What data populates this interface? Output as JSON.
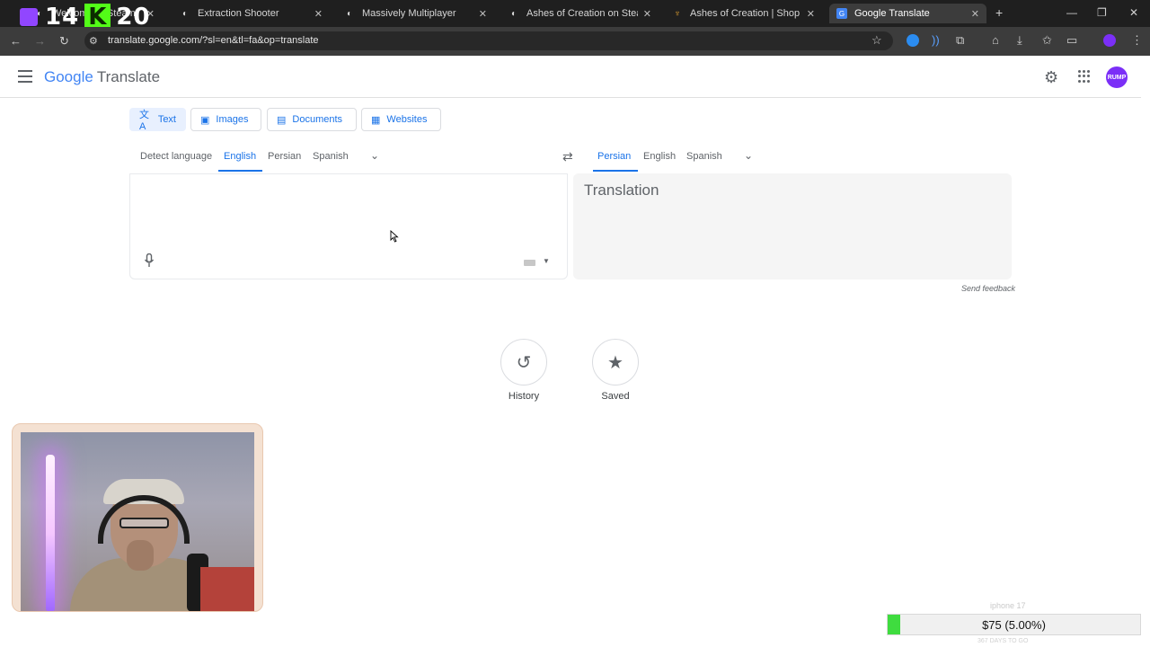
{
  "browser": {
    "tabs": [
      {
        "title": "Welcome to Steam",
        "active": false
      },
      {
        "title": "Extraction Shooter",
        "active": false
      },
      {
        "title": "Massively Multiplayer",
        "active": false
      },
      {
        "title": "Ashes of Creation on Steam",
        "active": false
      },
      {
        "title": "Ashes of Creation | Shop",
        "active": false
      },
      {
        "title": "Google Translate",
        "active": true
      }
    ],
    "new_tab_symbol": "+",
    "url": "translate.google.com/?sl=en&tl=fa&op=translate"
  },
  "overlay": {
    "left_number": "14",
    "k_letter": "K",
    "right_number": "20"
  },
  "app": {
    "logo_text": {
      "google": "Google",
      "product": "Translate"
    },
    "avatar_text": "RUMP"
  },
  "modes": [
    {
      "label": "Text",
      "icon": "translate-icon",
      "active": true
    },
    {
      "label": "Images",
      "icon": "image-icon",
      "active": false
    },
    {
      "label": "Documents",
      "icon": "document-icon",
      "active": false
    },
    {
      "label": "Websites",
      "icon": "website-icon",
      "active": false
    }
  ],
  "source_languages": [
    "Detect language",
    "English",
    "Persian",
    "Spanish"
  ],
  "source_selected": "English",
  "target_languages": [
    "Persian",
    "English",
    "Spanish"
  ],
  "target_selected": "Persian",
  "translation_placeholder": "Translation",
  "send_feedback": "Send feedback",
  "history_label": "History",
  "saved_label": "Saved",
  "goal": {
    "top_label": "iphone 17",
    "amount_text": "$75 (5.00%)",
    "progress_percent": 5,
    "bottom_label": "367 DAYS TO GO"
  },
  "colors": {
    "accent": "#1a73e8",
    "goal_fill": "#3fdc3f",
    "kick_green": "#53fc18"
  }
}
